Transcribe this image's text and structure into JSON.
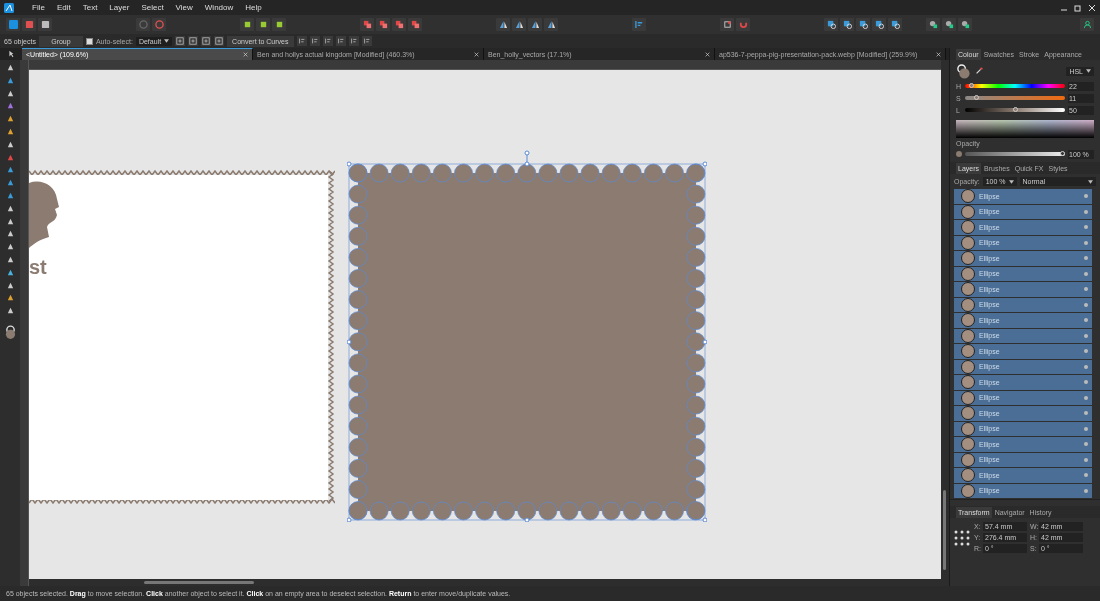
{
  "menu": [
    "File",
    "Edit",
    "Text",
    "Layer",
    "Select",
    "View",
    "Window",
    "Help"
  ],
  "context_bar": {
    "object_count": "65 objects",
    "group_button": "Group",
    "auto_select": {
      "label": "Auto-select:",
      "checked": true
    },
    "select_mode": "Default",
    "convert_button": "Convert to Curves"
  },
  "tabs": [
    {
      "label": "<Untitled> (109.6%)",
      "selected": true
    },
    {
      "label": "Ben and hollys actual kingdom [Modified] (460.3%)",
      "selected": false
    },
    {
      "label": "Ben_holly_vectors (17.1%)",
      "selected": false
    },
    {
      "label": "ap536-7-peppa-pig-presentation-pack.webp [Modified] (259.9%)",
      "selected": false
    }
  ],
  "canvas": {
    "stamp_text": "st"
  },
  "colour_panel": {
    "tabs": [
      {
        "label": "Colour",
        "selected": true
      },
      {
        "label": "Swatches",
        "selected": false
      },
      {
        "label": "Stroke",
        "selected": false
      },
      {
        "label": "Appearance",
        "selected": false
      }
    ],
    "model": "HSL",
    "sliders": [
      {
        "label": "H",
        "kind": "hue",
        "level": 0.06,
        "reading": "22"
      },
      {
        "label": "S",
        "kind": "saturation",
        "level": 0.11,
        "reading": "11"
      },
      {
        "label": "L",
        "kind": "lightness",
        "level": 0.5,
        "reading": "50"
      }
    ],
    "opacity_label": "Opacity",
    "opacity": {
      "level": 1,
      "reading": "100 %"
    }
  },
  "layers_panel": {
    "tabs": [
      {
        "label": "Layers",
        "selected": true
      },
      {
        "label": "Brushes",
        "selected": false
      },
      {
        "label": "Quick FX",
        "selected": false
      },
      {
        "label": "Styles",
        "selected": false
      }
    ],
    "opacity_label": "Opacity:",
    "opacity": "100 %",
    "blend_mode": "Normal",
    "layers": [
      {
        "name": "Ellipse",
        "selected": true
      },
      {
        "name": "Ellipse",
        "selected": true
      },
      {
        "name": "Ellipse",
        "selected": true
      },
      {
        "name": "Ellipse",
        "selected": true
      },
      {
        "name": "Ellipse",
        "selected": true
      },
      {
        "name": "Ellipse",
        "selected": true
      },
      {
        "name": "Ellipse",
        "selected": true
      },
      {
        "name": "Ellipse",
        "selected": true
      },
      {
        "name": "Ellipse",
        "selected": true
      },
      {
        "name": "Ellipse",
        "selected": true
      },
      {
        "name": "Ellipse",
        "selected": true
      },
      {
        "name": "Ellipse",
        "selected": true
      },
      {
        "name": "Ellipse",
        "selected": true
      },
      {
        "name": "Ellipse",
        "selected": true
      },
      {
        "name": "Ellipse",
        "selected": true
      },
      {
        "name": "Ellipse",
        "selected": true
      },
      {
        "name": "Ellipse",
        "selected": true
      },
      {
        "name": "Ellipse",
        "selected": true
      },
      {
        "name": "Ellipse",
        "selected": true
      },
      {
        "name": "Ellipse",
        "selected": true
      }
    ]
  },
  "transform_panel": {
    "tabs": [
      {
        "label": "Transform",
        "selected": true
      },
      {
        "label": "Navigator",
        "selected": false
      },
      {
        "label": "History",
        "selected": false
      }
    ],
    "fields": [
      {
        "label": "X:",
        "value": "57.4 mm"
      },
      {
        "label": "W:",
        "value": "42 mm"
      },
      {
        "label": "Y:",
        "value": "276.4 mm"
      },
      {
        "label": "H:",
        "value": "42 mm"
      },
      {
        "label": "R:",
        "value": "0 °"
      },
      {
        "label": "S:",
        "value": "0 °"
      }
    ]
  },
  "status_bar": "65 objects selected. **Drag** to move selection. **Click** another object to select it. **Click** on an empty area to deselect selection. **Return** to enter move/duplicate values."
}
